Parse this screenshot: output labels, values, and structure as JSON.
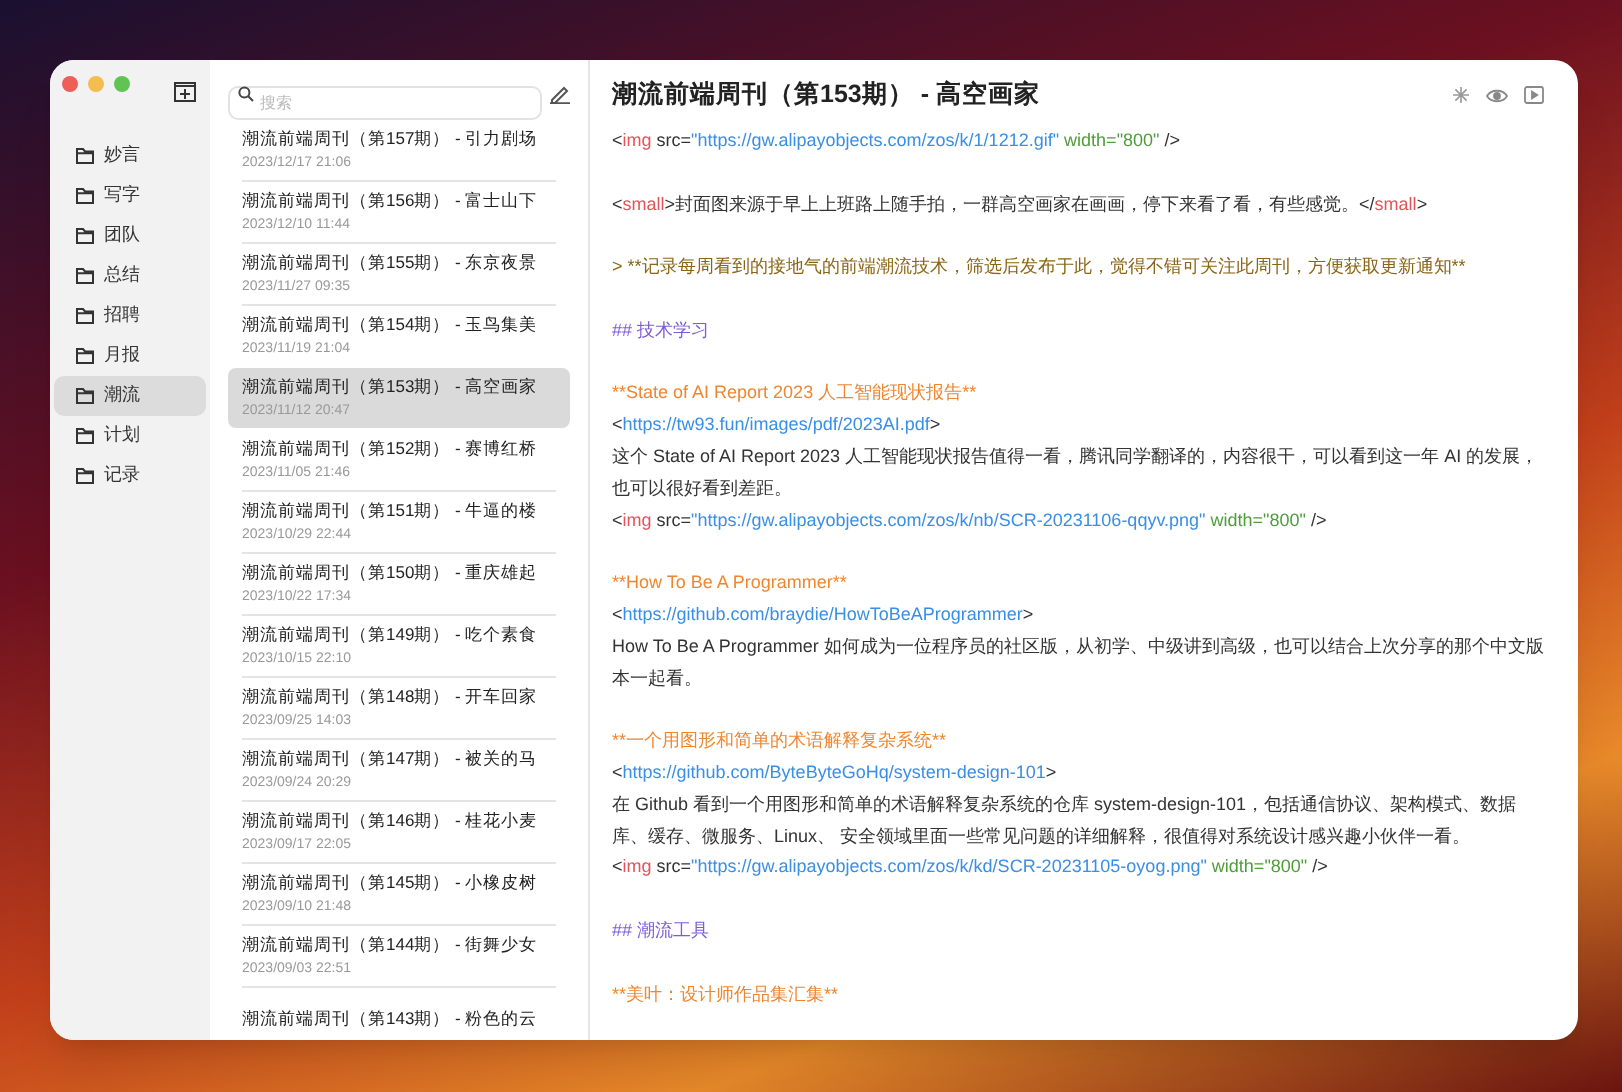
{
  "sidebar": {
    "items": [
      {
        "label": "妙言",
        "selected": false
      },
      {
        "label": "写字",
        "selected": false
      },
      {
        "label": "团队",
        "selected": false
      },
      {
        "label": "总结",
        "selected": false
      },
      {
        "label": "招聘",
        "selected": false
      },
      {
        "label": "月报",
        "selected": false
      },
      {
        "label": "潮流",
        "selected": true
      },
      {
        "label": "计划",
        "selected": false
      },
      {
        "label": "记录",
        "selected": false
      }
    ]
  },
  "search": {
    "placeholder": "搜索"
  },
  "notes": [
    {
      "title": "潮流前端周刊（第157期） - 引力剧场",
      "date": "2023/12/17 21:06",
      "selected": false
    },
    {
      "title": "潮流前端周刊（第156期） - 富士山下",
      "date": "2023/12/10 11:44",
      "selected": false
    },
    {
      "title": "潮流前端周刊（第155期） - 东京夜景",
      "date": "2023/11/27 09:35",
      "selected": false
    },
    {
      "title": "潮流前端周刊（第154期） - 玉鸟集美",
      "date": "2023/11/19 21:04",
      "selected": false
    },
    {
      "title": "潮流前端周刊（第153期） - 高空画家",
      "date": "2023/11/12 20:47",
      "selected": true
    },
    {
      "title": "潮流前端周刊（第152期） - 赛博红桥",
      "date": "2023/11/05 21:46",
      "selected": false
    },
    {
      "title": "潮流前端周刊（第151期） - 牛逼的楼",
      "date": "2023/10/29 22:44",
      "selected": false
    },
    {
      "title": "潮流前端周刊（第150期） - 重庆雄起",
      "date": "2023/10/22 17:34",
      "selected": false
    },
    {
      "title": "潮流前端周刊（第149期） - 吃个素食",
      "date": "2023/10/15 22:10",
      "selected": false
    },
    {
      "title": "潮流前端周刊（第148期） - 开车回家",
      "date": "2023/09/25 14:03",
      "selected": false
    },
    {
      "title": "潮流前端周刊（第147期） - 被关的马",
      "date": "2023/09/24 20:29",
      "selected": false
    },
    {
      "title": "潮流前端周刊（第146期） - 桂花小麦",
      "date": "2023/09/17 22:05",
      "selected": false
    },
    {
      "title": "潮流前端周刊（第145期） - 小橡皮树",
      "date": "2023/09/10 21:48",
      "selected": false
    },
    {
      "title": "潮流前端周刊（第144期） - 街舞少女",
      "date": "2023/09/03 22:51",
      "selected": false
    },
    {
      "title": "潮流前端周刊（第143期） - 粉色的云",
      "selected": false
    }
  ],
  "editor": {
    "title": "潮流前端周刊（第153期） - 高空画家",
    "blocks": [
      [
        [
          {
            "kind": "text",
            "text": "<"
          },
          {
            "kind": "tag",
            "text": "img"
          },
          {
            "kind": "text",
            "text": " src="
          },
          {
            "kind": "url",
            "text": "\"https://gw.alipayobjects.com/zos/k/1/1212.gif\""
          },
          {
            "kind": "value",
            "text": " width=\"800\""
          },
          {
            "kind": "text",
            "text": " />"
          }
        ]
      ],
      [
        [
          {
            "kind": "text",
            "text": "<"
          },
          {
            "kind": "tag",
            "text": "small"
          },
          {
            "kind": "text",
            "text": ">封面图来源于早上上班路上随手拍，一群高空画家在画画，停下来看了看，有些感觉。</"
          },
          {
            "kind": "tag",
            "text": "small"
          },
          {
            "kind": "text",
            "text": ">"
          }
        ]
      ],
      [
        [
          {
            "kind": "quote",
            "text": "> **记录每周看到的接地气的前端潮流技术，筛选后发布于此，觉得不错可关注此周刊，方便获取更新通知**"
          }
        ]
      ],
      [
        [
          {
            "kind": "heading",
            "text": "## 技术学习"
          }
        ]
      ],
      [
        [
          {
            "kind": "strong",
            "text": "**State of AI Report 2023 人工智能现状报告**"
          }
        ],
        [
          {
            "kind": "text",
            "text": "<"
          },
          {
            "kind": "url",
            "text": "https://tw93.fun/images/pdf/2023AI.pdf"
          },
          {
            "kind": "text",
            "text": ">"
          }
        ],
        [
          {
            "kind": "text",
            "text": "这个 State of AI Report 2023 人工智能现状报告值得一看，腾讯同学翻译的，内容很干，可以看到这一年 AI 的发展，也可以很好看到差距。"
          }
        ],
        [
          {
            "kind": "text",
            "text": "<"
          },
          {
            "kind": "tag",
            "text": "img"
          },
          {
            "kind": "text",
            "text": " src="
          },
          {
            "kind": "url",
            "text": "\"https://gw.alipayobjects.com/zos/k/nb/SCR-20231106-qqyv.png\""
          },
          {
            "kind": "value",
            "text": " width=\"800\""
          },
          {
            "kind": "text",
            "text": " />"
          }
        ]
      ],
      [
        [
          {
            "kind": "strong",
            "text": "**How To Be A Programmer**"
          }
        ],
        [
          {
            "kind": "text",
            "text": "<"
          },
          {
            "kind": "url",
            "text": "https://github.com/braydie/HowToBeAProgrammer"
          },
          {
            "kind": "text",
            "text": ">"
          }
        ],
        [
          {
            "kind": "text",
            "text": "How To Be A Programmer 如何成为一位程序员的社区版，从初学、中级讲到高级，也可以结合上次分享的那个中文版本一起看。"
          }
        ]
      ],
      [
        [
          {
            "kind": "strong",
            "text": "**一个用图形和简单的术语解释复杂系统**"
          }
        ],
        [
          {
            "kind": "text",
            "text": "<"
          },
          {
            "kind": "url",
            "text": "https://github.com/ByteByteGoHq/system-design-101"
          },
          {
            "kind": "text",
            "text": ">"
          }
        ],
        [
          {
            "kind": "text",
            "text": "在 Github 看到一个用图形和简单的术语解释复杂系统的仓库 system-design-101，包括通信协议、架构模式、数据库、缓存、微服务、Linux、 安全领域里面一些常见问题的详细解释，很值得对系统设计感兴趣小伙伴一看。"
          }
        ],
        [
          {
            "kind": "text",
            "text": "<"
          },
          {
            "kind": "tag",
            "text": "img"
          },
          {
            "kind": "text",
            "text": " src="
          },
          {
            "kind": "url",
            "text": "\"https://gw.alipayobjects.com/zos/k/kd/SCR-20231105-oyog.png\""
          },
          {
            "kind": "value",
            "text": " width=\"800\""
          },
          {
            "kind": "text",
            "text": " />"
          }
        ]
      ],
      [
        [
          {
            "kind": "heading",
            "text": "## 潮流工具"
          }
        ]
      ],
      [
        [
          {
            "kind": "strong",
            "text": "**美叶：设计师作品集汇集**"
          }
        ]
      ]
    ]
  }
}
